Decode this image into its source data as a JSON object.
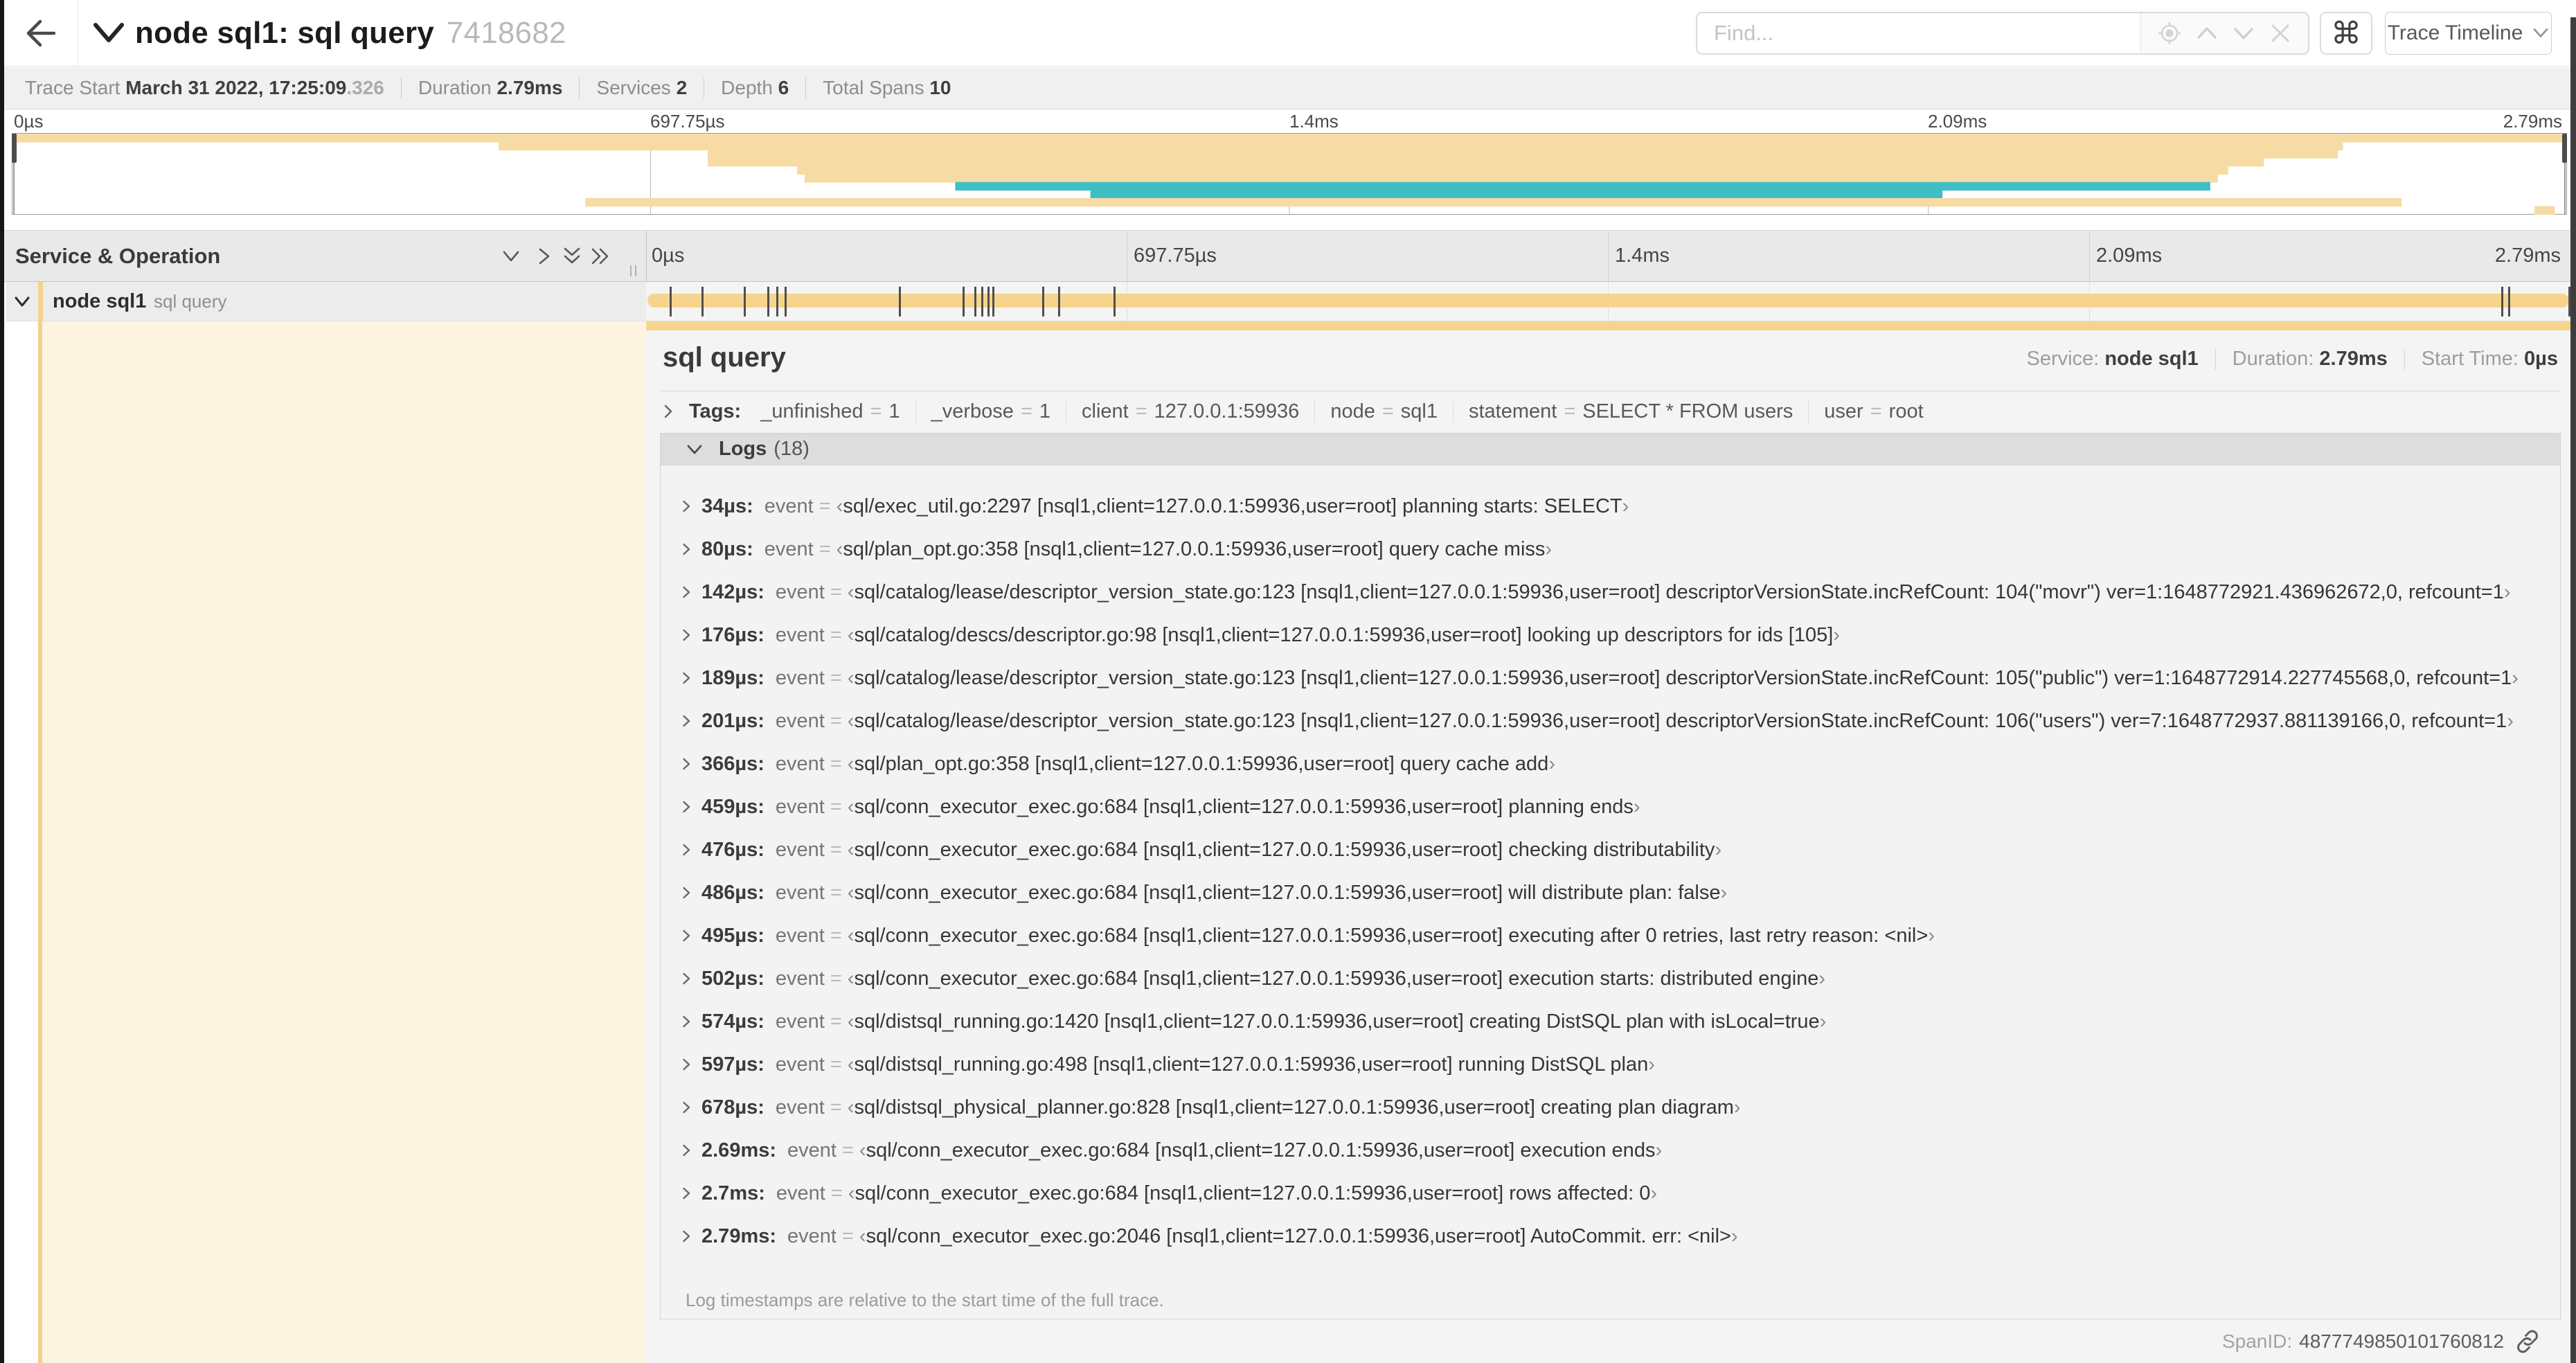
{
  "colors": {
    "service_yellow": "#f7d48c",
    "service_yellow_light": "#f6dba4",
    "service_teal": "#3fbfc5",
    "detail_left_cream": "#fcf3e1"
  },
  "topbar": {
    "title": "node sql1: sql query",
    "trace_id": "7418682",
    "find_placeholder": "Find...",
    "command_glyph": "⌘",
    "view_label": "Trace Timeline"
  },
  "summary": {
    "trace_start_label": "Trace Start",
    "trace_start_value": "March 31 2022, 17:25:09",
    "trace_start_ms": ".326",
    "duration_label": "Duration",
    "duration_value": "2.79ms",
    "services_label": "Services",
    "services_value": "2",
    "depth_label": "Depth",
    "depth_value": "6",
    "total_spans_label": "Total Spans",
    "total_spans_value": "10"
  },
  "minimap": {
    "ticks": [
      "0µs",
      "697.75µs",
      "1.4ms",
      "2.09ms",
      "2.79ms"
    ],
    "spans": [
      {
        "start": 0.0,
        "end": 1.0,
        "service": "yellow"
      },
      {
        "start": 0.19,
        "end": 0.913,
        "service": "yellow"
      },
      {
        "start": 0.272,
        "end": 0.911,
        "service": "yellow"
      },
      {
        "start": 0.272,
        "end": 0.882,
        "service": "yellow"
      },
      {
        "start": 0.307,
        "end": 0.868,
        "service": "yellow"
      },
      {
        "start": 0.31,
        "end": 0.864,
        "service": "yellow"
      },
      {
        "start": 0.369,
        "end": 0.861,
        "service": "teal"
      },
      {
        "start": 0.422,
        "end": 0.756,
        "service": "teal"
      },
      {
        "start": 0.224,
        "end": 0.936,
        "service": "yellow"
      },
      {
        "start": 0.988,
        "end": 0.996,
        "service": "yellow"
      }
    ]
  },
  "timeline_header": {
    "title": "Service & Operation",
    "ticks": [
      "0µs",
      "697.75µs",
      "1.4ms",
      "2.09ms",
      "2.79ms"
    ]
  },
  "span_row": {
    "service": "node sql1",
    "operation": "sql query",
    "log_marks_us": [
      34,
      80,
      142,
      176,
      189,
      201,
      366,
      459,
      476,
      486,
      495,
      502,
      574,
      597,
      678,
      2690,
      2700,
      2790
    ],
    "total_us": 2790
  },
  "detail": {
    "operation": "sql query",
    "service_label": "Service:",
    "service_value": "node sql1",
    "duration_label": "Duration:",
    "duration_value": "2.79ms",
    "start_label": "Start Time:",
    "start_value": "0µs",
    "tags_label": "Tags:",
    "tags": [
      {
        "key": "_unfinished",
        "eq": "=",
        "value": "1"
      },
      {
        "key": "_verbose",
        "eq": "=",
        "value": "1"
      },
      {
        "key": "client",
        "eq": "=",
        "value": "127.0.0.1:59936"
      },
      {
        "key": "node",
        "eq": "=",
        "value": "sql1"
      },
      {
        "key": "statement",
        "eq": "=",
        "value": "SELECT * FROM users"
      },
      {
        "key": "user",
        "eq": "=",
        "value": "root"
      }
    ],
    "logs_label": "Logs",
    "logs_count": "(18)",
    "log_field": "event",
    "log_eq": "=",
    "quote_open": "‹",
    "quote_close": "›",
    "logs": [
      {
        "t": "34µs:",
        "value": "sql/exec_util.go:2297 [nsql1,client=127.0.0.1:59936,user=root] planning starts: SELECT"
      },
      {
        "t": "80µs:",
        "value": "sql/plan_opt.go:358 [nsql1,client=127.0.0.1:59936,user=root] query cache miss"
      },
      {
        "t": "142µs:",
        "value": "sql/catalog/lease/descriptor_version_state.go:123 [nsql1,client=127.0.0.1:59936,user=root] descriptorVersionState.incRefCount: 104(\"movr\") ver=1:1648772921.436962672,0, refcount=1"
      },
      {
        "t": "176µs:",
        "value": "sql/catalog/descs/descriptor.go:98 [nsql1,client=127.0.0.1:59936,user=root] looking up descriptors for ids [105]"
      },
      {
        "t": "189µs:",
        "value": "sql/catalog/lease/descriptor_version_state.go:123 [nsql1,client=127.0.0.1:59936,user=root] descriptorVersionState.incRefCount: 105(\"public\") ver=1:1648772914.227745568,0, refcount=1"
      },
      {
        "t": "201µs:",
        "value": "sql/catalog/lease/descriptor_version_state.go:123 [nsql1,client=127.0.0.1:59936,user=root] descriptorVersionState.incRefCount: 106(\"users\") ver=7:1648772937.881139166,0, refcount=1"
      },
      {
        "t": "366µs:",
        "value": "sql/plan_opt.go:358 [nsql1,client=127.0.0.1:59936,user=root] query cache add"
      },
      {
        "t": "459µs:",
        "value": "sql/conn_executor_exec.go:684 [nsql1,client=127.0.0.1:59936,user=root] planning ends"
      },
      {
        "t": "476µs:",
        "value": "sql/conn_executor_exec.go:684 [nsql1,client=127.0.0.1:59936,user=root] checking distributability"
      },
      {
        "t": "486µs:",
        "value": "sql/conn_executor_exec.go:684 [nsql1,client=127.0.0.1:59936,user=root] will distribute plan: false"
      },
      {
        "t": "495µs:",
        "value": "sql/conn_executor_exec.go:684 [nsql1,client=127.0.0.1:59936,user=root] executing after 0 retries, last retry reason: <nil>"
      },
      {
        "t": "502µs:",
        "value": "sql/conn_executor_exec.go:684 [nsql1,client=127.0.0.1:59936,user=root] execution starts: distributed engine"
      },
      {
        "t": "574µs:",
        "value": "sql/distsql_running.go:1420 [nsql1,client=127.0.0.1:59936,user=root] creating DistSQL plan with isLocal=true"
      },
      {
        "t": "597µs:",
        "value": "sql/distsql_running.go:498 [nsql1,client=127.0.0.1:59936,user=root] running DistSQL plan"
      },
      {
        "t": "678µs:",
        "value": "sql/distsql_physical_planner.go:828 [nsql1,client=127.0.0.1:59936,user=root] creating plan diagram"
      },
      {
        "t": "2.69ms:",
        "value": "sql/conn_executor_exec.go:684 [nsql1,client=127.0.0.1:59936,user=root] execution ends"
      },
      {
        "t": "2.7ms:",
        "value": "sql/conn_executor_exec.go:684 [nsql1,client=127.0.0.1:59936,user=root] rows affected: 0"
      },
      {
        "t": "2.79ms:",
        "value": "sql/conn_executor_exec.go:2046 [nsql1,client=127.0.0.1:59936,user=root] AutoCommit. err: <nil>"
      }
    ],
    "footer": "Log timestamps are relative to the start time of the full trace.",
    "spanid_label": "SpanID:",
    "spanid_value": "4877749850101760812"
  }
}
